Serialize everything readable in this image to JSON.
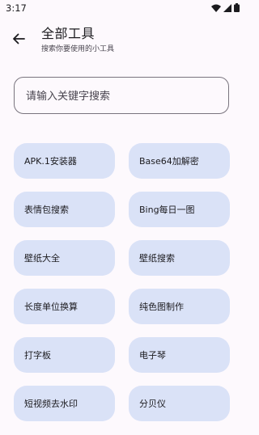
{
  "status_bar": {
    "time": "3:17"
  },
  "header": {
    "title": "全部工具",
    "subtitle": "搜索你要使用的小工具"
  },
  "search": {
    "placeholder": "请输入关键字搜索",
    "value": ""
  },
  "tools": [
    {
      "label": "APK.1安装器"
    },
    {
      "label": "Base64加解密"
    },
    {
      "label": "表情包搜索"
    },
    {
      "label": "Bing每日一图"
    },
    {
      "label": "壁纸大全"
    },
    {
      "label": "壁纸搜索"
    },
    {
      "label": "长度单位换算"
    },
    {
      "label": "纯色图制作"
    },
    {
      "label": "打字板"
    },
    {
      "label": "电子琴"
    },
    {
      "label": "短视频去水印"
    },
    {
      "label": "分贝仪"
    }
  ],
  "colors": {
    "background": "#fdf9fd",
    "chip": "#dae2f7",
    "outline": "#79747e"
  },
  "icons": [
    "wifi-icon",
    "cellular-signal-icon",
    "battery-icon",
    "arrow-back-icon"
  ]
}
